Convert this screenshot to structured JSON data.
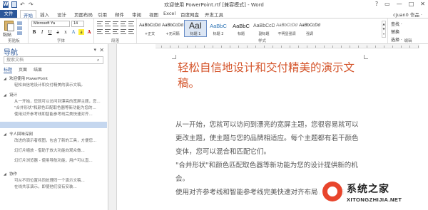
{
  "window": {
    "title": "欢迎使用 PowerPoint.rtf [兼容模式] - Word",
    "controls": [
      "?",
      "▭",
      "—",
      "□",
      "✕"
    ],
    "account": "cjuan0 作品 ·"
  },
  "quick_access": [
    "word-icon",
    "save-icon",
    "undo-icon",
    "redo-icon"
  ],
  "tabs": [
    {
      "label": "文件"
    },
    {
      "label": "开始"
    },
    {
      "label": "插入"
    },
    {
      "label": "设计"
    },
    {
      "label": "页面布局"
    },
    {
      "label": "引用"
    },
    {
      "label": "邮件"
    },
    {
      "label": "审阅"
    },
    {
      "label": "视图"
    },
    {
      "label": "Excel"
    },
    {
      "label": "百度网盘"
    },
    {
      "label": "开发工具"
    }
  ],
  "ribbon": {
    "clipboard": {
      "label": "剪贴板",
      "paste": "粘贴"
    },
    "font": {
      "label": "字体",
      "name": "Microsoft Ya",
      "size": "14"
    },
    "paragraph": {
      "label": "段落"
    },
    "styles": {
      "label": "样式",
      "items": [
        {
          "sample": "AaBbCcDd",
          "name": "+正文"
        },
        {
          "sample": "AaBbCcDd",
          "name": "+无间隔"
        },
        {
          "sample": "AaI",
          "name": "标题 1"
        },
        {
          "sample": "AaBbC",
          "name": "标题 2"
        },
        {
          "sample": "AaBbC",
          "name": "标题"
        },
        {
          "sample": "AaBbCcD",
          "name": "副标题"
        },
        {
          "sample": "AaBbCcDd",
          "name": "不明显强调"
        },
        {
          "sample": "AaBbCcDd",
          "name": "强调"
        }
      ]
    },
    "editing": {
      "label": "编辑",
      "items": [
        "查找 ·",
        "替换",
        "选择 ·"
      ]
    }
  },
  "nav": {
    "title": "导航",
    "pin": "▾",
    "close": "✕",
    "search_placeholder": "搜索文档",
    "tabs": [
      "标题",
      "页面",
      "结果"
    ],
    "items": [
      {
        "level": 1,
        "tri": "◢",
        "text": "欢迎使用 PowerPoint"
      },
      {
        "level": 2,
        "text": "轻松自信地设计和交付精美的演示文稿。"
      },
      {
        "gap": true
      },
      {
        "level": 1,
        "tri": "◢",
        "text": "设计"
      },
      {
        "level": 2,
        "text": "从一开始，您就可以访问到漂亮的宽屏主题，您..."
      },
      {
        "level": 2,
        "text": "\"合并形状\"和颜色匹配取色器等新功能为您的..."
      },
      {
        "level": 2,
        "text": "使用对齐参考线和智能参考线完美快速对齐..."
      },
      {
        "gap": true
      },
      {
        "level": 2,
        "text": "",
        "selected": true
      },
      {
        "gap": true
      },
      {
        "level": 1,
        "tri": "◢",
        "text": "令人回味深刻"
      },
      {
        "level": 2,
        "text": "改进的演示者视图，包含了新的工具，方便您..."
      },
      {
        "gap": true
      },
      {
        "level": 2,
        "text": "幻灯片缩放 - 借助于放大功能向观众做..."
      },
      {
        "gap": true
      },
      {
        "level": 2,
        "text": "幻灯片浏览器 - 使用导航功能，用户可以直..."
      },
      {
        "gap": true
      },
      {
        "gap": true
      },
      {
        "level": 1,
        "tri": "◢",
        "text": "协作"
      },
      {
        "level": 2,
        "text": "可从不同位置共同处理同一个演示文稿..."
      },
      {
        "level": 2,
        "text": "在线共享演示，即使他们没有安装..."
      }
    ]
  },
  "document": {
    "heading": "轻松自信地设计和交付精美的演示文稿。",
    "paragraphs": [
      "从一开始，您就可以访问到漂亮的宽屏主题，您很容易就可以更改主题，使主题与您的品牌相适应。每个主题都有若干颜色变体，您可以混合和匹配它们。",
      "\"合并形状\"和颜色匹配取色器等新功能为您的设计提供新的机会。",
      "使用对齐参考线和智能参考线完美快速对齐布局，图片与..."
    ]
  },
  "watermark": {
    "title": "系统之家",
    "url": "XITONGZHIJIA.NET"
  }
}
